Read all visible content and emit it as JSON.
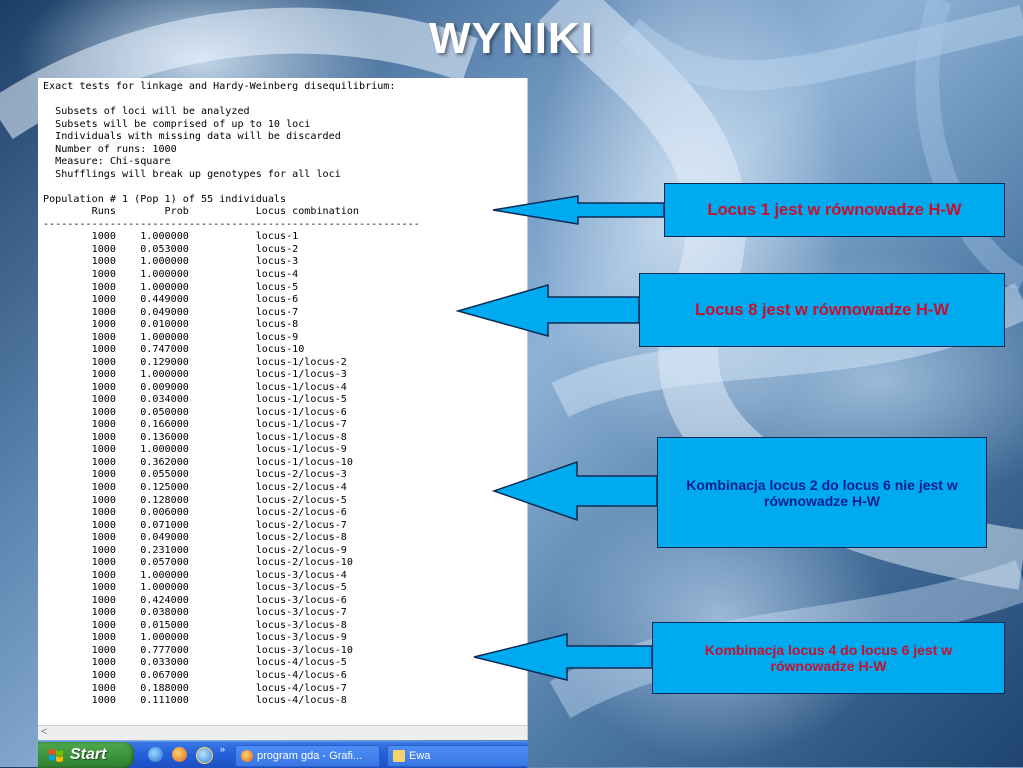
{
  "slide": {
    "title": "WYNIKI"
  },
  "terminal": {
    "lines": [
      "Exact tests for linkage and Hardy-Weinberg disequilibrium:",
      "",
      "  Subsets of loci will be analyzed",
      "  Subsets will be comprised of up to 10 loci",
      "  Individuals with missing data will be discarded",
      "  Number of runs: 1000",
      "  Measure: Chi-square",
      "  Shufflings will break up genotypes for all loci",
      "",
      "Population # 1 (Pop 1) of 55 individuals",
      "        Runs        Prob           Locus combination",
      "--------------------------------------------------------------",
      "        1000    1.000000           locus-1",
      "        1000    0.053000           locus-2",
      "        1000    1.000000           locus-3",
      "        1000    1.000000           locus-4",
      "        1000    1.000000           locus-5",
      "        1000    0.449000           locus-6",
      "        1000    0.049000           locus-7",
      "        1000    0.010000           locus-8",
      "        1000    1.000000           locus-9",
      "        1000    0.747000           locus-10",
      "        1000    0.129000           locus-1/locus-2",
      "        1000    1.000000           locus-1/locus-3",
      "        1000    0.009000           locus-1/locus-4",
      "        1000    0.034000           locus-1/locus-5",
      "        1000    0.050000           locus-1/locus-6",
      "        1000    0.166000           locus-1/locus-7",
      "        1000    0.136000           locus-1/locus-8",
      "        1000    1.000000           locus-1/locus-9",
      "        1000    0.362000           locus-1/locus-10",
      "        1000    0.055000           locus-2/locus-3",
      "        1000    0.125000           locus-2/locus-4",
      "        1000    0.128000           locus-2/locus-5",
      "        1000    0.006000           locus-2/locus-6",
      "        1000    0.071000           locus-2/locus-7",
      "        1000    0.049000           locus-2/locus-8",
      "        1000    0.231000           locus-2/locus-9",
      "        1000    0.057000           locus-2/locus-10",
      "        1000    1.000000           locus-3/locus-4",
      "        1000    1.000000           locus-3/locus-5",
      "        1000    0.424000           locus-3/locus-6",
      "        1000    0.038000           locus-3/locus-7",
      "        1000    0.015000           locus-3/locus-8",
      "        1000    1.000000           locus-3/locus-9",
      "        1000    0.777000           locus-3/locus-10",
      "        1000    0.033000           locus-4/locus-5",
      "        1000    0.067000           locus-4/locus-6",
      "        1000    0.188000           locus-4/locus-7",
      "        1000    0.111000           locus-4/locus-8"
    ]
  },
  "taskbar": {
    "start_label": "Start",
    "quick_launch_icons": [
      "ie-icon",
      "firefox-icon",
      "browser-icon"
    ],
    "chevron": "»",
    "tasks": [
      {
        "label": "program gda - Grafi...",
        "icon": "firefox-icon"
      },
      {
        "label": "Ewa",
        "icon": "folder-icon"
      }
    ]
  },
  "callouts": {
    "c1": "Locus 1 jest w równowadze H-W",
    "c2": "Locus 8 jest w równowadze H-W",
    "c3": "Kombinacja locus 2 do locus 6 nie jest w równowadze H-W",
    "c4": "Kombinacja locus 4 do locus 6 jest w równowadze H-W"
  },
  "colors": {
    "callout_fill": "#00aaee",
    "callout_text_red": "#c8102e",
    "callout_text_blue": "#0a1f8f",
    "title": "#ffffff"
  }
}
